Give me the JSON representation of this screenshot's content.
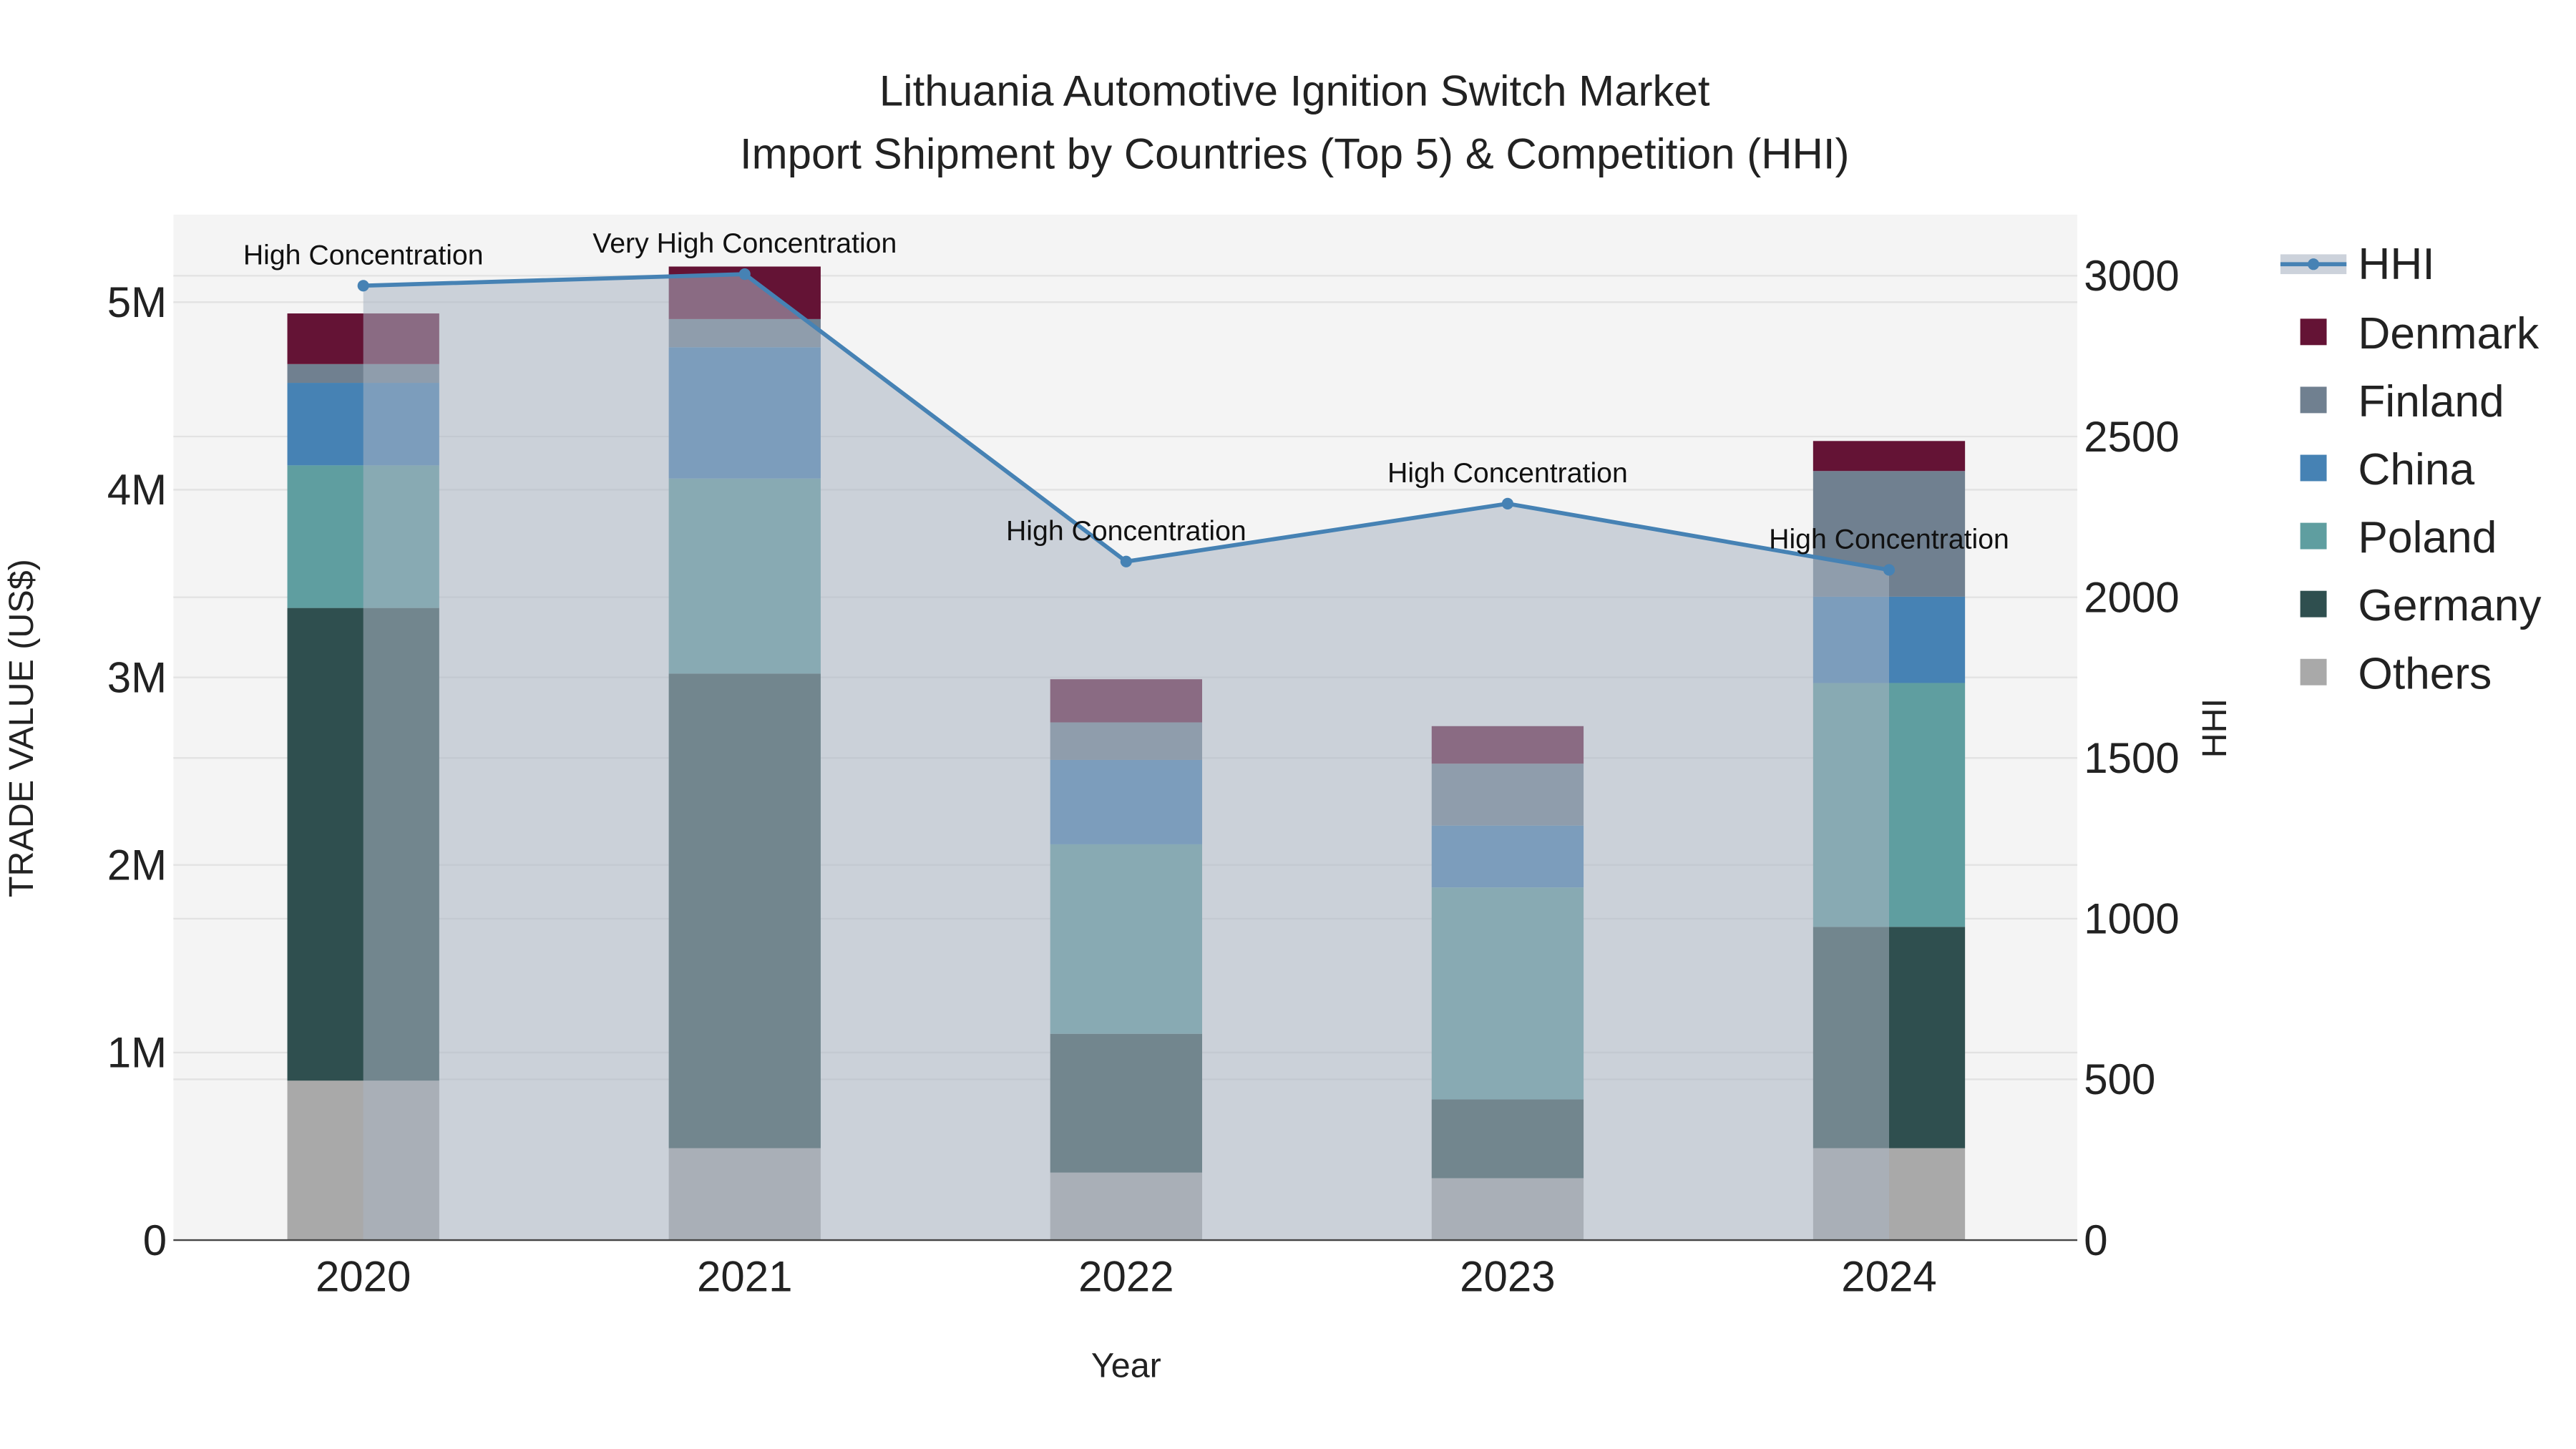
{
  "chart_data": {
    "type": "bar",
    "title_line1": "Lithuania Automotive Ignition Switch Market",
    "title_line2": "Import Shipment by Countries (Top 5) & Competition (HHI)",
    "xlabel": "Year",
    "ylabel": "TRADE VALUE (US$)",
    "y2label": "HHI",
    "categories": [
      "2020",
      "2021",
      "2022",
      "2023",
      "2024"
    ],
    "ylim": [
      0,
      5450000
    ],
    "y2lim": [
      0,
      3200
    ],
    "yticks": [
      {
        "v": 0,
        "label": "0"
      },
      {
        "v": 1000000,
        "label": "1M"
      },
      {
        "v": 2000000,
        "label": "2M"
      },
      {
        "v": 3000000,
        "label": "3M"
      },
      {
        "v": 4000000,
        "label": "4M"
      },
      {
        "v": 5000000,
        "label": "5M"
      }
    ],
    "y2ticks": [
      {
        "v": 0,
        "label": "0"
      },
      {
        "v": 500,
        "label": "500"
      },
      {
        "v": 1000,
        "label": "1000"
      },
      {
        "v": 1500,
        "label": "1500"
      },
      {
        "v": 2000,
        "label": "2000"
      },
      {
        "v": 2500,
        "label": "2500"
      },
      {
        "v": 3000,
        "label": "3000"
      }
    ],
    "series": [
      {
        "name": "Others",
        "color": "#A9A9A9",
        "values": [
          850000,
          490000,
          360000,
          330000,
          490000
        ]
      },
      {
        "name": "Germany",
        "color": "#2F4F4F",
        "values": [
          2520000,
          2530000,
          740000,
          420000,
          1180000
        ]
      },
      {
        "name": "Poland",
        "color": "#5F9EA0",
        "values": [
          760000,
          1040000,
          1010000,
          1130000,
          1300000
        ]
      },
      {
        "name": "China",
        "color": "#4682B4",
        "values": [
          440000,
          700000,
          450000,
          330000,
          460000
        ]
      },
      {
        "name": "Finland",
        "color": "#708090",
        "values": [
          100000,
          150000,
          200000,
          330000,
          670000
        ]
      },
      {
        "name": "Denmark",
        "color": "#641335",
        "values": [
          270000,
          280000,
          230000,
          200000,
          160000
        ]
      }
    ],
    "hhi": {
      "name": "HHI",
      "color": "#4682B4",
      "values": [
        2969,
        3005,
        2111,
        2291,
        2085
      ],
      "annotations": [
        "High Concentration",
        "Very High Concentration",
        "High Concentration",
        "High Concentration",
        "High Concentration"
      ]
    },
    "legend_order": [
      "HHI",
      "Denmark",
      "Finland",
      "China",
      "Poland",
      "Germany",
      "Others"
    ],
    "legend_position": "right",
    "grid": true
  }
}
